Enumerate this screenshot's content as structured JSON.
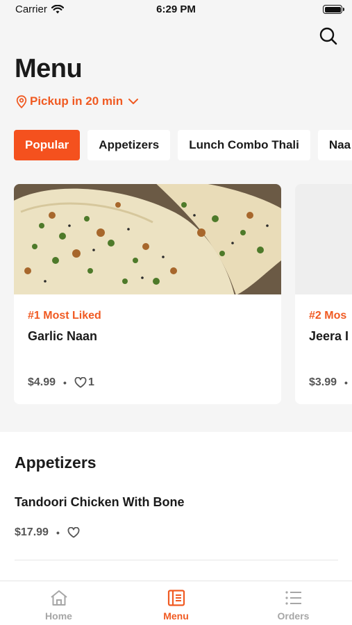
{
  "status_bar": {
    "carrier": "Carrier",
    "time": "6:29 PM"
  },
  "header": {
    "title": "Menu",
    "pickup": "Pickup in 20 min"
  },
  "categories": [
    {
      "label": "Popular",
      "active": true
    },
    {
      "label": "Appetizers",
      "active": false
    },
    {
      "label": "Lunch Combo Thali",
      "active": false
    },
    {
      "label": "Naa",
      "active": false
    }
  ],
  "featured": [
    {
      "rank": "#1 Most Liked",
      "name": "Garlic Naan",
      "price": "$4.99",
      "likes": "1"
    },
    {
      "rank": "#2 Mos",
      "name": "Jeera I",
      "price": "$3.99"
    }
  ],
  "section": {
    "title": "Appetizers",
    "items": [
      {
        "name": "Tandoori Chicken With Bone",
        "price": "$17.99"
      }
    ]
  },
  "tabs": [
    {
      "label": "Home",
      "icon": "home-icon"
    },
    {
      "label": "Menu",
      "icon": "menu-book-icon",
      "active": true
    },
    {
      "label": "Orders",
      "icon": "list-icon"
    }
  ],
  "colors": {
    "accent": "#f4511e",
    "background": "#f5f5f5"
  }
}
